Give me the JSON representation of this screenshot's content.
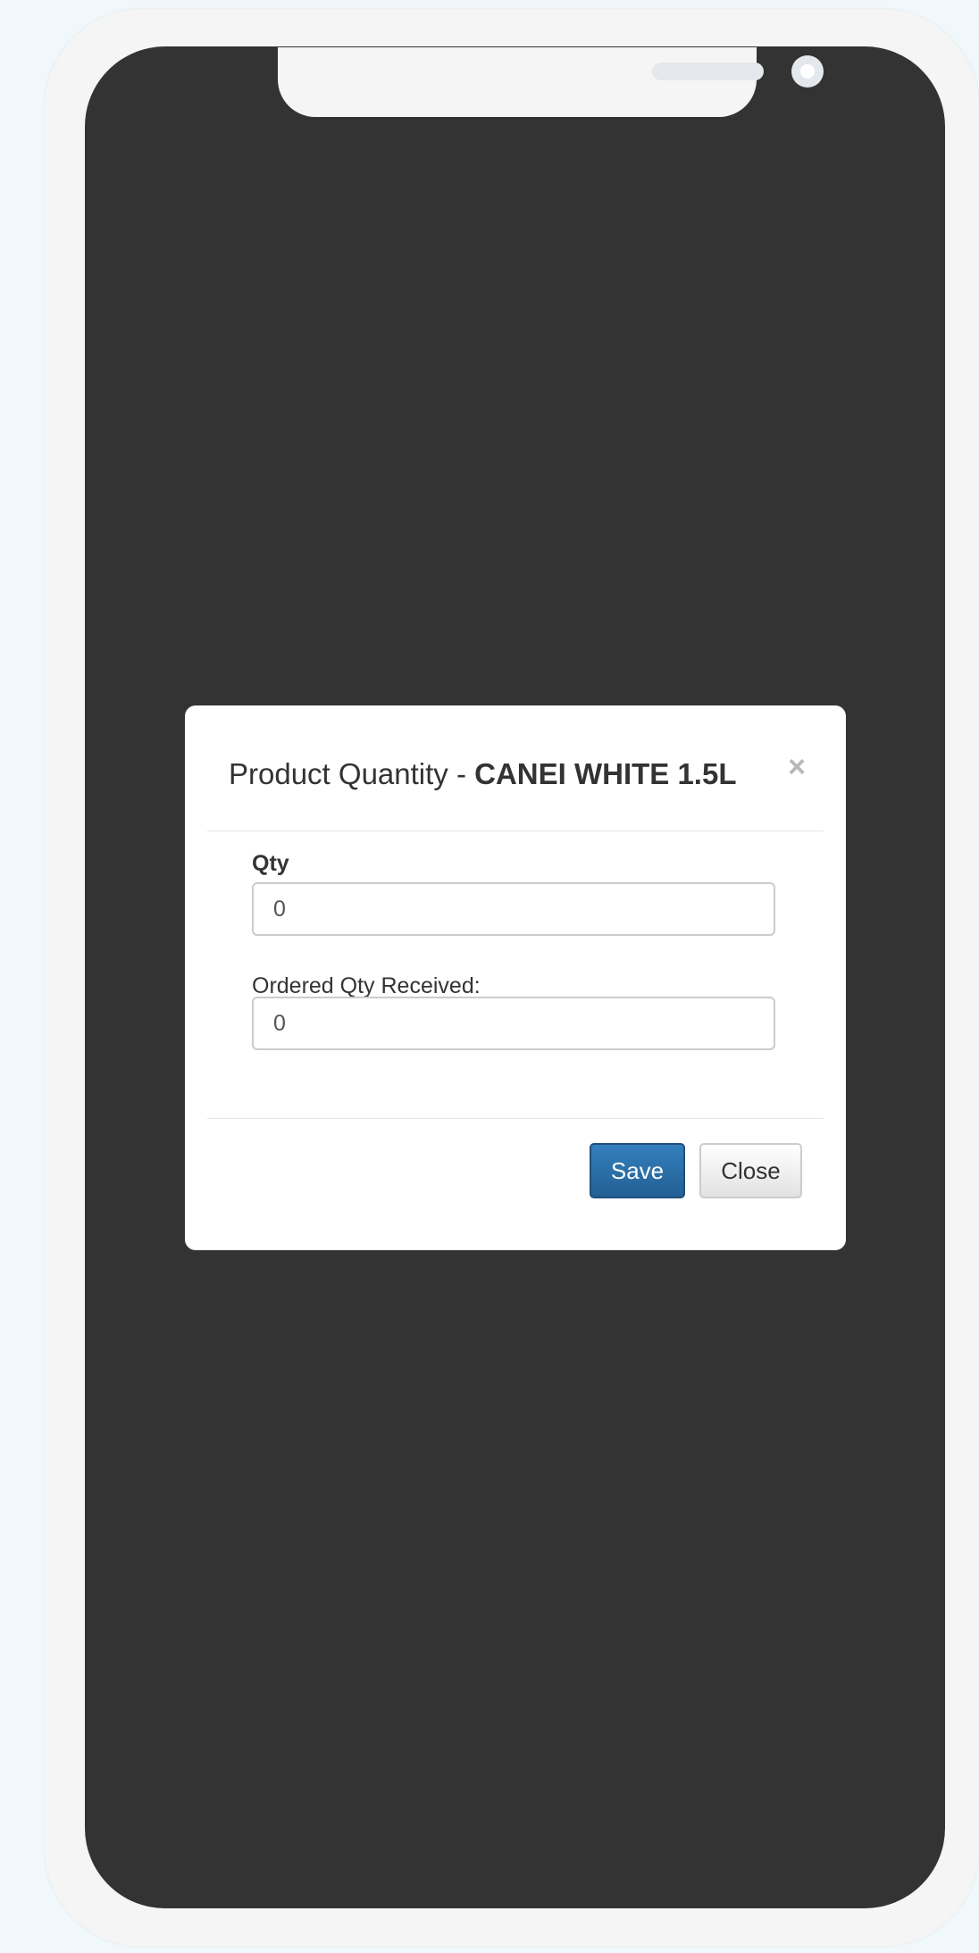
{
  "modal": {
    "title_prefix": "Product Quantity - ",
    "title_product": "CANEI WHITE 1.5L",
    "close_symbol": "×",
    "qty_label": "Qty",
    "qty_value": "0",
    "ordered_label": "Ordered Qty Received:",
    "ordered_value": "0",
    "save_label": "Save",
    "close_label": "Close"
  },
  "colors": {
    "primary": "#2a6fab",
    "overlay": "#333333",
    "device": "#f5f5f5"
  }
}
